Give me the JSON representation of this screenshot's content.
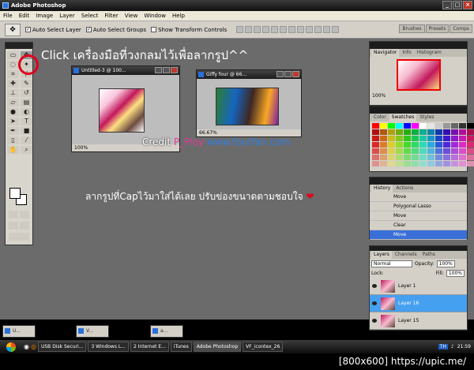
{
  "app": {
    "title": "Adobe Photoshop"
  },
  "menu": [
    "File",
    "Edit",
    "Image",
    "Layer",
    "Select",
    "Filter",
    "View",
    "Window",
    "Help"
  ],
  "options": {
    "auto_select_layer": "Auto Select Layer",
    "auto_select_groups": "Auto Select Groups",
    "show_transform": "Show Transform Controls"
  },
  "wells": [
    "Brushes",
    "Presets",
    "Comps"
  ],
  "annotations": {
    "click_text": "Click  เครื่องมือที่วงกลมไว้เพื่อลากรูป^^",
    "drag_text": "ลากรูปที่Capไว้มาใส่ได้เลย  ปรับข่องขนาดตามชอบใจ",
    "credit_prefix": "Credit ",
    "credit_name": "P_Ploy",
    "credit_url": "www.fourfan.com"
  },
  "docs": [
    {
      "title": "Untitled-3 @ 100...",
      "zoom": "100%"
    },
    {
      "title": "Giffy four @ 66...",
      "zoom": "66.67%"
    }
  ],
  "navigator": {
    "tabs": [
      "Navigator",
      "Info",
      "Histogram"
    ],
    "zoom": "100%"
  },
  "color_panel": {
    "tabs": [
      "Color",
      "Swatches",
      "Styles"
    ]
  },
  "history": {
    "tabs": [
      "History",
      "Actions"
    ],
    "items": [
      "Move",
      "Polygonal Lasso",
      "Move",
      "Clear",
      "Move"
    ]
  },
  "layers": {
    "tabs": [
      "Layers",
      "Channels",
      "Paths"
    ],
    "blend": "Normal",
    "opacity_label": "Opacity:",
    "opacity": "100%",
    "lock_label": "Lock:",
    "fill_label": "Fill:",
    "fill": "100%",
    "items": [
      "Layer 1",
      "Layer 16",
      "Layer 15"
    ]
  },
  "minimized": [
    "U...",
    "V...",
    "a..."
  ],
  "taskbar": {
    "items": [
      "USB Disk Securi...",
      "3 Windows L...",
      "2 Internet E...",
      "iTunes",
      "Adobe Photoshop",
      "VF_icontex_26"
    ],
    "lang": "TH",
    "time": "21:59"
  },
  "watermark": "[800x600] https://upic.me/",
  "swatch_colors": [
    "#ff0000",
    "#ffff00",
    "#00ff00",
    "#00ffff",
    "#0000ff",
    "#ff00ff",
    "#ffffff",
    "#e6e6e6",
    "#cccccc",
    "#999999",
    "#666666",
    "#333333",
    "#000000"
  ]
}
